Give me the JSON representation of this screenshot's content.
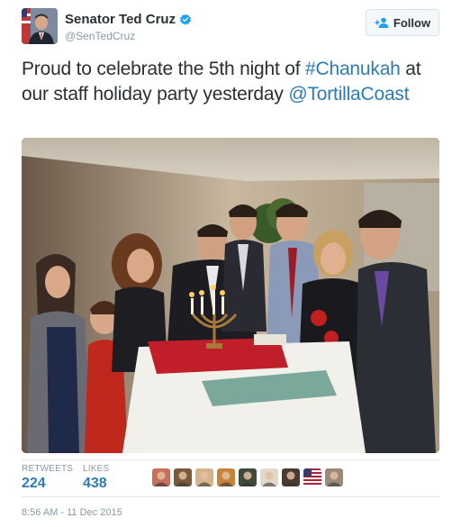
{
  "author": {
    "name": "Senator Ted Cruz",
    "handle": "@SenTedCruz",
    "verified": true,
    "avatar_icon": "profile-photo"
  },
  "follow_button": {
    "label": "Follow",
    "icon": "add-user-icon"
  },
  "tweet": {
    "text_part1": "Proud to celebrate the 5th night of ",
    "hashtag": "#Chanukah",
    "text_part2": " at our staff holiday party yesterday ",
    "mention": "@TortillaCoast",
    "link_color": "#2b7bb9"
  },
  "photo": {
    "kind": "group-photo-menorah-lighting"
  },
  "stats": {
    "retweets_label": "RETWEETS",
    "retweets_value": "224",
    "likes_label": "LIKES",
    "likes_value": "438"
  },
  "likers": [
    {
      "icon": "liker-avatar",
      "color": "#c9705a"
    },
    {
      "icon": "liker-avatar",
      "color": "#7a5a3a"
    },
    {
      "icon": "liker-avatar",
      "color": "#d4b48a"
    },
    {
      "icon": "liker-avatar",
      "color": "#c9823a"
    },
    {
      "icon": "liker-avatar",
      "color": "#3f4a3a"
    },
    {
      "icon": "liker-avatar",
      "color": "#e0d8c8"
    },
    {
      "icon": "liker-avatar",
      "color": "#4a3a32"
    },
    {
      "icon": "flag-avatar",
      "color": "#b22234"
    },
    {
      "icon": "liker-avatar",
      "color": "#9a8a7a"
    }
  ],
  "timestamp": "8:56 AM - 11 Dec 2015"
}
